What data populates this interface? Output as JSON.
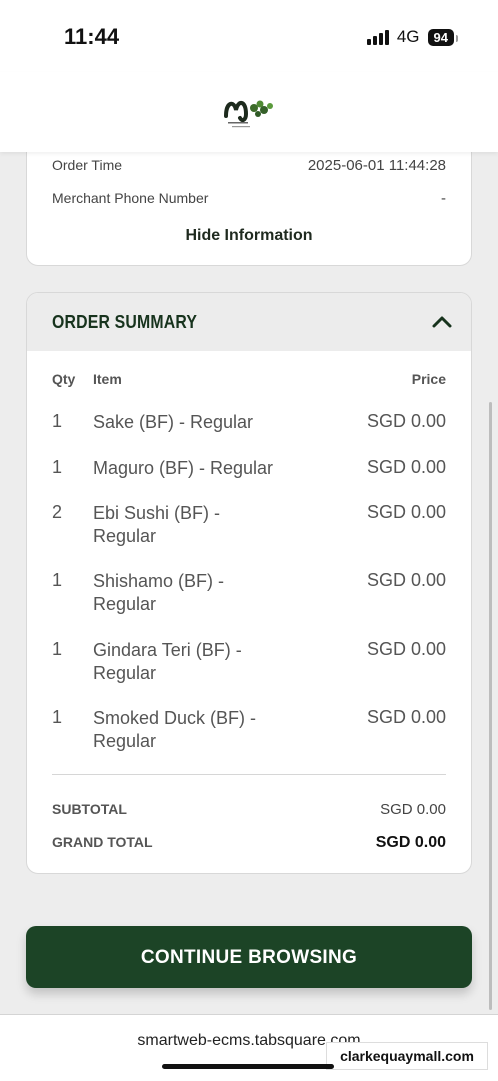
{
  "status_bar": {
    "time": "11:44",
    "network": "4G",
    "battery": "94"
  },
  "header": {
    "logo": "mitsuba"
  },
  "order_info": {
    "rows": [
      {
        "label": "Order Time",
        "value": "2025-06-01 11:44:28"
      },
      {
        "label": "Merchant Phone Number",
        "value": "-"
      }
    ],
    "hide_label": "Hide Information"
  },
  "order_summary": {
    "title": "ORDER SUMMARY",
    "columns": {
      "qty": "Qty",
      "item": "Item",
      "price": "Price"
    },
    "items": [
      {
        "qty": "1",
        "name": "Sake (BF) - Regular",
        "price": "SGD 0.00"
      },
      {
        "qty": "1",
        "name": "Maguro (BF) - Regular",
        "price": "SGD 0.00"
      },
      {
        "qty": "2",
        "name": "Ebi Sushi (BF) - Regular",
        "price": "SGD 0.00"
      },
      {
        "qty": "1",
        "name": "Shishamo (BF) - Regular",
        "price": "SGD 0.00"
      },
      {
        "qty": "1",
        "name": "Gindara Teri (BF) - Regular",
        "price": "SGD 0.00"
      },
      {
        "qty": "1",
        "name": "Smoked Duck (BF) - Regular",
        "price": "SGD 0.00"
      }
    ],
    "subtotal": {
      "label": "SUBTOTAL",
      "value": "SGD 0.00"
    },
    "grand_total": {
      "label": "GRAND TOTAL",
      "value": "SGD 0.00"
    }
  },
  "continue_button": {
    "label": "CONTINUE BROWSING"
  },
  "browser": {
    "url": "smartweb-ecms.tabsquare.com"
  },
  "watermark": "clarkequaymall.com",
  "colors": {
    "brand_green": "#1c4426",
    "title_green": "#17331d"
  }
}
